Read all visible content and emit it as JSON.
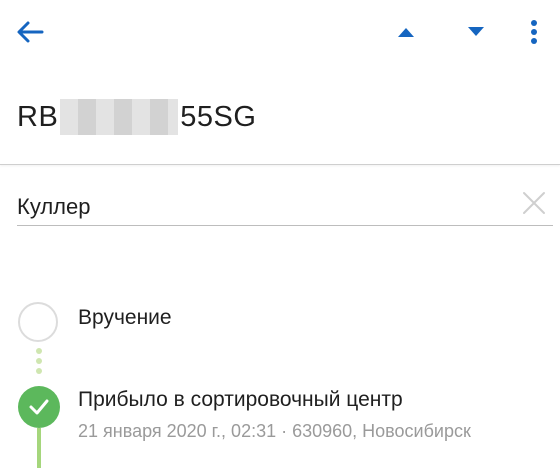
{
  "toolbar": {
    "back_icon": "arrow-left-icon",
    "prev_icon": "triangle-up-icon",
    "next_icon": "triangle-down-icon",
    "menu_icon": "more-vertical-icon",
    "icon_color": "#1565c0"
  },
  "tracking": {
    "prefix": "RB",
    "suffix": "55SG"
  },
  "name_field": {
    "value": "Куллер",
    "clear_icon": "close-icon"
  },
  "timeline": {
    "steps": [
      {
        "label": "Вручение",
        "status": "pending"
      },
      {
        "label": "Прибыло в сортировочный центр",
        "status": "done",
        "meta": "21 января 2020 г., 02:31 · 630960, Новосибирск"
      }
    ],
    "accent_color": "#5cb85c"
  }
}
